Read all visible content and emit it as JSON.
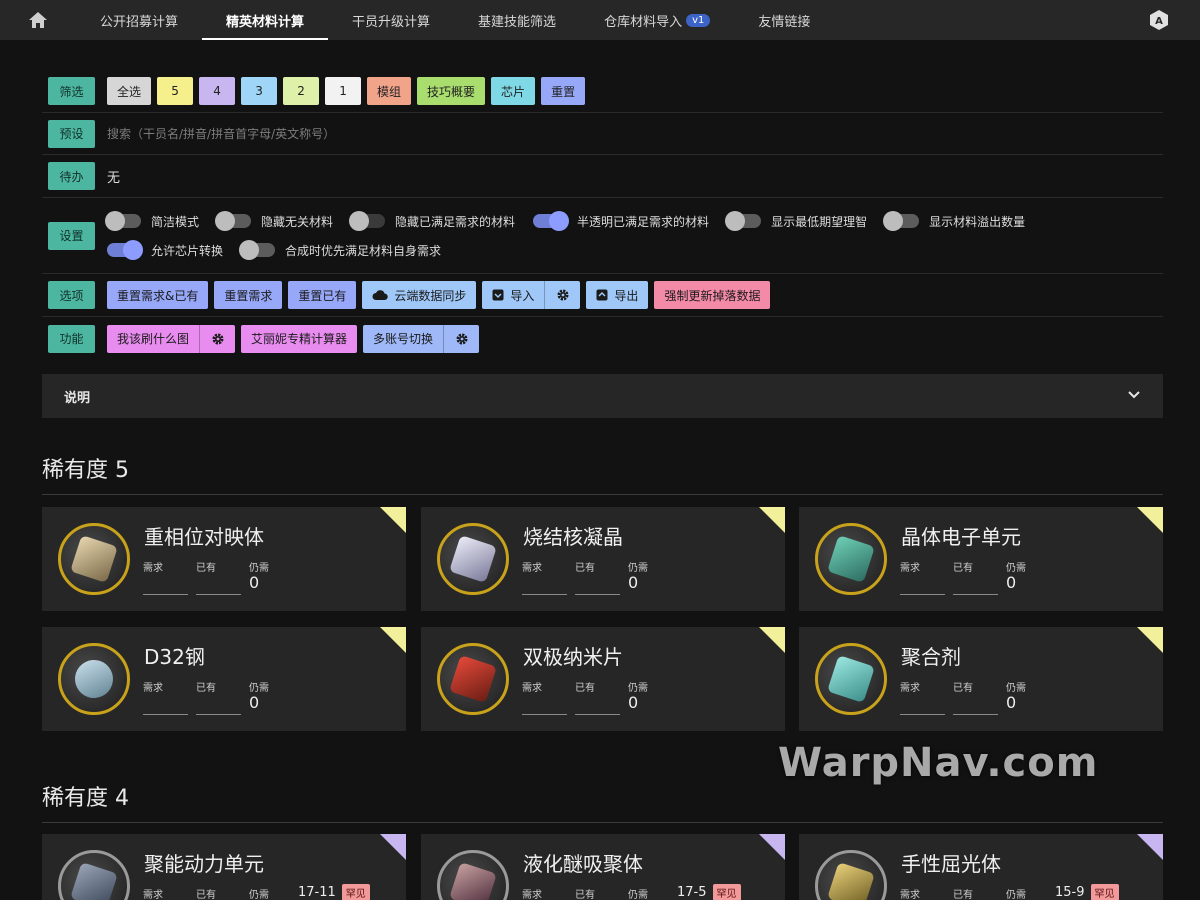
{
  "nav": {
    "tabs": [
      {
        "label": "公开招募计算"
      },
      {
        "label": "精英材料计算",
        "active": true
      },
      {
        "label": "干员升级计算"
      },
      {
        "label": "基建技能筛选"
      },
      {
        "label": "仓库材料导入",
        "badge": "v1"
      },
      {
        "label": "友情链接"
      }
    ],
    "home_icon": "home-icon",
    "right_icon": "translate-icon"
  },
  "filter": {
    "label": "筛选",
    "chips": [
      {
        "label": "全选",
        "color": "#d6d6d6"
      },
      {
        "label": "5",
        "color": "#f5f08c"
      },
      {
        "label": "4",
        "color": "#c7b6f0"
      },
      {
        "label": "3",
        "color": "#9fd6f8"
      },
      {
        "label": "2",
        "color": "#dff0a8"
      },
      {
        "label": "1",
        "color": "#f2f2f2"
      },
      {
        "label": "模组",
        "color": "#f2a48a"
      },
      {
        "label": "技巧概要",
        "color": "#a9dd6e"
      },
      {
        "label": "芯片",
        "color": "#7fd8e6"
      },
      {
        "label": "重置",
        "color": "#97a8f8"
      }
    ]
  },
  "preset": {
    "label": "预设",
    "placeholder": "搜索（干员名/拼音/拼音首字母/英文称号）"
  },
  "todo": {
    "label": "待办",
    "value": "无"
  },
  "settings": {
    "label": "设置",
    "toggles": [
      {
        "label": "简洁模式",
        "on": false
      },
      {
        "label": "隐藏无关材料",
        "on": false
      },
      {
        "label": "隐藏已满足需求的材料",
        "on": false
      },
      {
        "label": "半透明已满足需求的材料",
        "on": true
      },
      {
        "label": "显示最低期望理智",
        "on": false
      },
      {
        "label": "显示材料溢出数量",
        "on": false
      },
      {
        "label": "允许芯片转换",
        "on": true
      },
      {
        "label": "合成时优先满足材料自身需求",
        "on": false
      }
    ]
  },
  "options": {
    "label": "选项",
    "reset_all": "重置需求&已有",
    "reset_need": "重置需求",
    "reset_have": "重置已有",
    "cloud_sync": "云端数据同步",
    "import": "导入",
    "export": "导出",
    "force_update": "强制更新掉落数据",
    "colors": {
      "blue": "#97a8f8",
      "light_blue": "#9fc8f8",
      "pink": "#f38aa8"
    }
  },
  "functions": {
    "label": "功能",
    "what_to_farm": "我该刷什么图",
    "alienni_calc": "艾丽妮专精计算器",
    "multi_account": "多账号切换",
    "colors": {
      "magenta": "#e98cf0",
      "blue": "#9fb8f8"
    }
  },
  "explain": {
    "label": "说明"
  },
  "field_labels": {
    "need": "需求",
    "have": "已有",
    "still": "仍需"
  },
  "rarity5": {
    "title": "稀有度 5",
    "items": [
      {
        "name": "重相位对映体",
        "still": "0"
      },
      {
        "name": "烧结核凝晶",
        "still": "0"
      },
      {
        "name": "晶体电子单元",
        "still": "0"
      },
      {
        "name": "D32钢",
        "still": "0"
      },
      {
        "name": "双极纳米片",
        "still": "0"
      },
      {
        "name": "聚合剂",
        "still": "0"
      }
    ]
  },
  "rarity4": {
    "title": "稀有度 4",
    "items": [
      {
        "name": "聚能动力单元",
        "time": "17-11",
        "tag": "罕见"
      },
      {
        "name": "液化醚吸聚体",
        "time": "17-5",
        "tag": "罕见"
      },
      {
        "name": "手性屈光体",
        "time": "15-9",
        "tag": "罕见"
      }
    ]
  },
  "watermark": "WarpNav.com"
}
